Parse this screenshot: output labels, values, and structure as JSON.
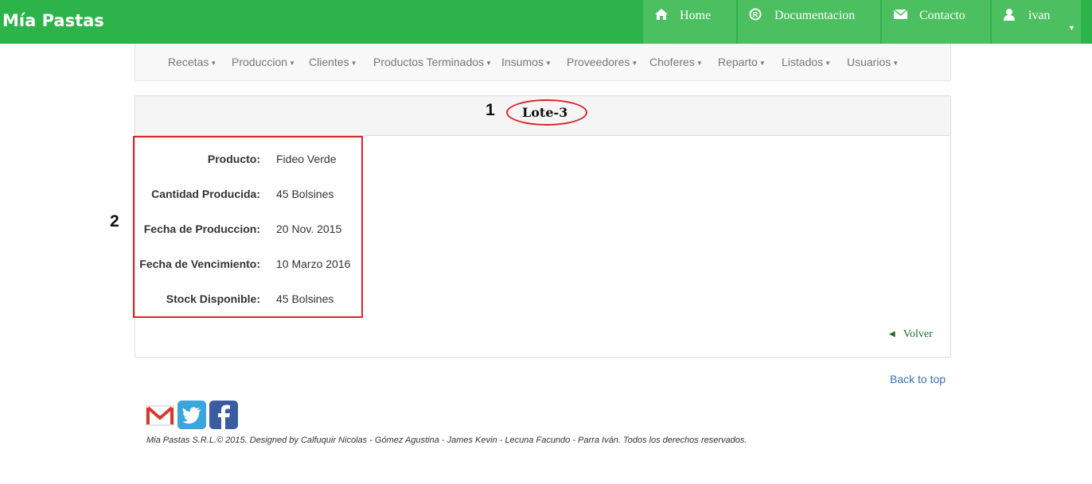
{
  "app": {
    "brand": "Mía Pastas"
  },
  "topnav": {
    "home": "Home",
    "docs": "Documentacion",
    "contact": "Contacto",
    "user": "ivan"
  },
  "subnav": {
    "items": [
      "Recetas",
      "Produccion",
      "Clientes",
      "Productos Terminados",
      "Insumos",
      "Proveedores",
      "Choferes",
      "Reparto",
      "Listados",
      "Usuarios"
    ]
  },
  "panel": {
    "title": "Lote-3",
    "annotation_1": "1",
    "annotation_2": "2",
    "fields": [
      {
        "label": "Producto:",
        "value": "Fideo Verde"
      },
      {
        "label": "Cantidad Producida:",
        "value": "45 Bolsines"
      },
      {
        "label": "Fecha de Produccion:",
        "value": "20 Nov. 2015"
      },
      {
        "label": "Fecha de Vencimiento:",
        "value": "10 Marzo 2016"
      },
      {
        "label": "Stock Disponible:",
        "value": "45 Bolsines"
      }
    ],
    "back_link": "Volver"
  },
  "back_to_top": "Back to top",
  "social_icons": [
    "gmail-icon",
    "twitter-icon",
    "facebook-icon"
  ],
  "footer": "Mia Pastas S.R.L.© 2015. Designed by Calfuquir Nicolas - Gómez Agustina - James Kevin - Lecuna Facundo - Parra Iván. Todos los derechos reservados.",
  "colors": {
    "brand_green": "#2cb34a",
    "annotation_red": "#d9242b",
    "link_blue": "#3a72a9"
  }
}
